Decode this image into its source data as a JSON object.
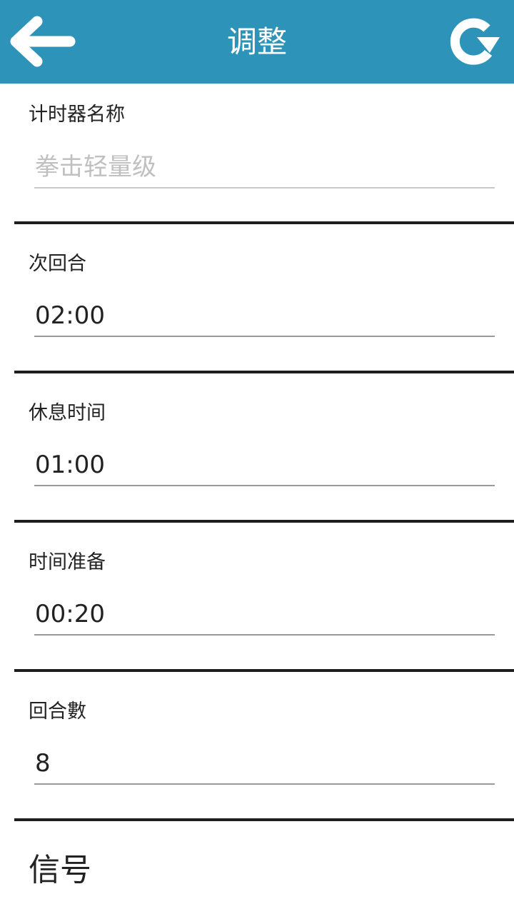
{
  "header": {
    "title": "调整",
    "back_icon": "arrow-left-icon",
    "reset_icon": "refresh-icon",
    "bg_color": "#2e93b8"
  },
  "fields": {
    "timer_name": {
      "label": "计时器名称",
      "value": "",
      "placeholder": "拳击轻量级"
    },
    "round_time": {
      "label": "次回合",
      "value": "02:00"
    },
    "rest_time": {
      "label": "休息时间",
      "value": "01:00"
    },
    "prep_time": {
      "label": "时间准备",
      "value": "00:20"
    },
    "rounds": {
      "label": "回合數",
      "value": "8"
    }
  },
  "signal_section": {
    "title": "信号"
  }
}
